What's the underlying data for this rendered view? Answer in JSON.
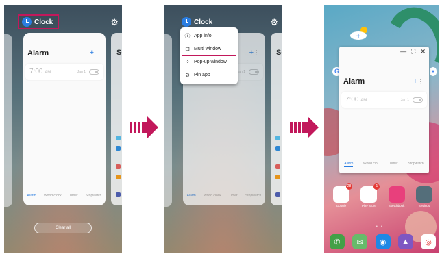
{
  "recents": {
    "app_name": "Clock",
    "side_app_title": "Se",
    "clear_all": "Clear all"
  },
  "clock_app": {
    "title": "Alarm",
    "add": "+",
    "more": "⋮",
    "alarm_time": "7:00",
    "alarm_ampm": "AM",
    "alarm_days": "Jan 1",
    "tabs": [
      "Alarm",
      "World clock",
      "Timer",
      "Stopwatch"
    ]
  },
  "context_menu": {
    "items": [
      {
        "icon": "ⓘ",
        "label": "App info"
      },
      {
        "icon": "⊟",
        "label": "Multi window"
      },
      {
        "icon": "⁘",
        "label": "Pop-up window"
      },
      {
        "icon": "⊘",
        "label": "Pin app"
      }
    ]
  },
  "popup": {
    "controls": [
      "—",
      "⛶",
      "✕"
    ],
    "tabs": [
      "Alarm",
      "World clo..",
      "Timer",
      "Stopwatch"
    ]
  },
  "home": {
    "search_letter": "G",
    "apps": [
      {
        "label": "Google",
        "badge": "28",
        "color": "#ffffff"
      },
      {
        "label": "Play Store",
        "badge": "1",
        "color": "#ffffff"
      },
      {
        "label": "Sketchbook",
        "badge": "",
        "color": "#e8407c"
      },
      {
        "label": "Settings",
        "badge": "",
        "color": "#546e7a"
      }
    ],
    "dock": [
      {
        "icon": "✆",
        "color": "#43a047"
      },
      {
        "icon": "✉",
        "color": "#66bb6a"
      },
      {
        "icon": "◉",
        "color": "#1e88e5"
      },
      {
        "icon": "▲",
        "color": "#7e57c2"
      },
      {
        "icon": "◎",
        "color": "#ffffff"
      }
    ]
  },
  "colors": {
    "highlight": "#c2185b",
    "accent": "#2a7de1"
  }
}
